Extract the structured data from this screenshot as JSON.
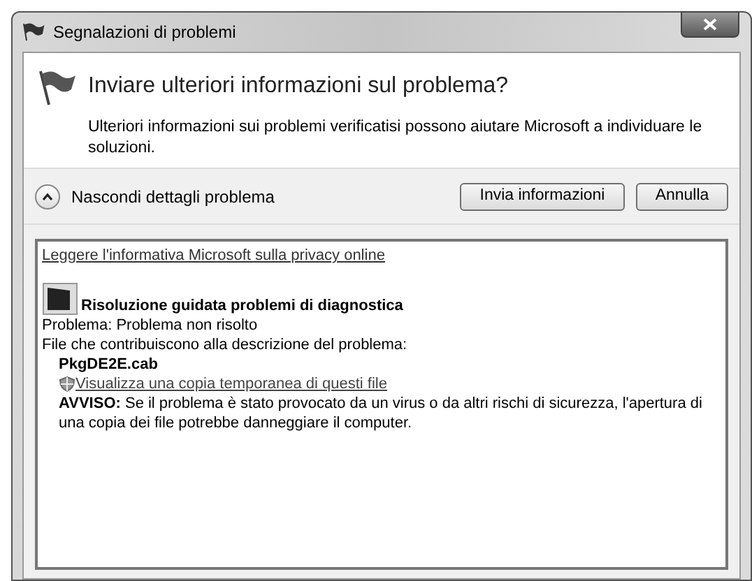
{
  "window": {
    "title": "Segnalazioni di problemi"
  },
  "header": {
    "title": "Inviare ulteriori informazioni sul problema?",
    "description": "Ulteriori informazioni sui problemi verificatisi possono aiutare Microsoft a individuare le soluzioni."
  },
  "details_toggle": {
    "label": "Nascondi dettagli problema",
    "expanded": true
  },
  "buttons": [
    "Invia informazioni",
    "Annulla"
  ],
  "details": {
    "privacy_link": "Leggere l'informativa Microsoft sulla privacy online",
    "app_name": "Risoluzione guidata problemi di diagnostica",
    "problem": "Problema: Problema non risolto",
    "files_label": "File che contribuiscono alla descrizione del problema:",
    "file_name": "PkgDE2E.cab",
    "view_link": "Visualizza una copia temporanea di questi file",
    "warning": "**AVVISO:** Se il problema è stato provocato da un virus o da altri rischi di sicurezza, l'apertura di una copia dei file potrebbe danneggiare il computer."
  }
}
